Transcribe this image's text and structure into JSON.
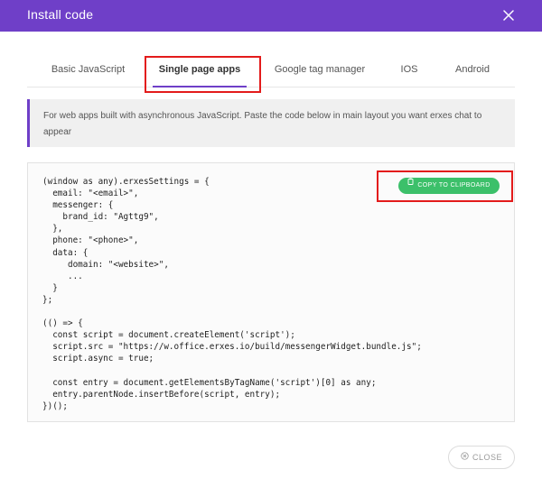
{
  "header": {
    "title": "Install code",
    "close_icon": "close-icon"
  },
  "tabs": [
    {
      "label": "Basic JavaScript"
    },
    {
      "label": "Single page apps",
      "active": true
    },
    {
      "label": "Google tag manager"
    },
    {
      "label": "IOS"
    },
    {
      "label": "Android"
    }
  ],
  "info": {
    "text": "For web apps built with asynchronous JavaScript. Paste the code below in main layout you want erxes chat to appear"
  },
  "code": {
    "text": "(window as any).erxesSettings = {\n  email: \"<email>\",\n  messenger: {\n    brand_id: \"Agttg9\",\n  },\n  phone: \"<phone>\",\n  data: {\n     domain: \"<website>\",\n     ...\n  }\n};\n\n(() => {\n  const script = document.createElement('script');\n  script.src = \"https://w.office.erxes.io/build/messengerWidget.bundle.js\";\n  script.async = true;\n\n  const entry = document.getElementsByTagName('script')[0] as any;\n  entry.parentNode.insertBefore(script, entry);\n})();"
  },
  "copy_button": {
    "label": "COPY TO CLIPBOARD",
    "icon": "clipboard-icon"
  },
  "close_button": {
    "label": "CLOSE",
    "icon": "cancel-circle-icon"
  },
  "colors": {
    "header": "#6f3fc8",
    "accent": "#6f3fc8",
    "copy_button": "#3cc06a",
    "highlight": "#e31b1b"
  }
}
